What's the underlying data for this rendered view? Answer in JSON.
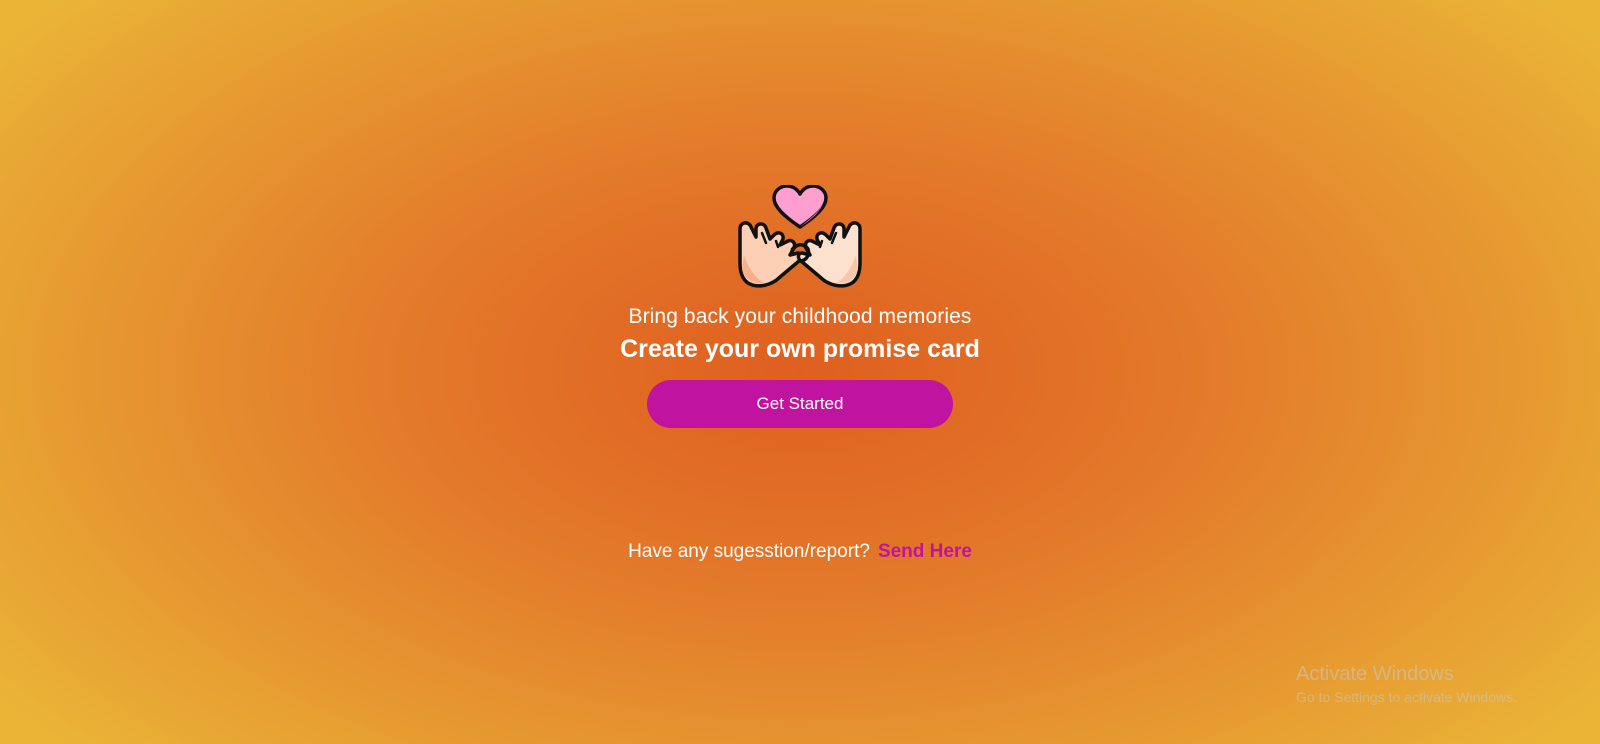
{
  "hero": {
    "illustration_icon": "pinky-promise-hands-heart-icon",
    "tagline": "Bring back your childhood memories",
    "headline": "Create your own promise card",
    "cta_label": "Get Started"
  },
  "feedback": {
    "question": "Have any sugesstion/report?",
    "link_label": "Send Here"
  },
  "os_watermark": {
    "title": "Activate Windows",
    "subtitle": "Go to Settings to activate Windows."
  },
  "colors": {
    "background_center": "#df5f1f",
    "background_edge": "#eab437",
    "accent": "#c0139f",
    "text": "#ffffff"
  }
}
